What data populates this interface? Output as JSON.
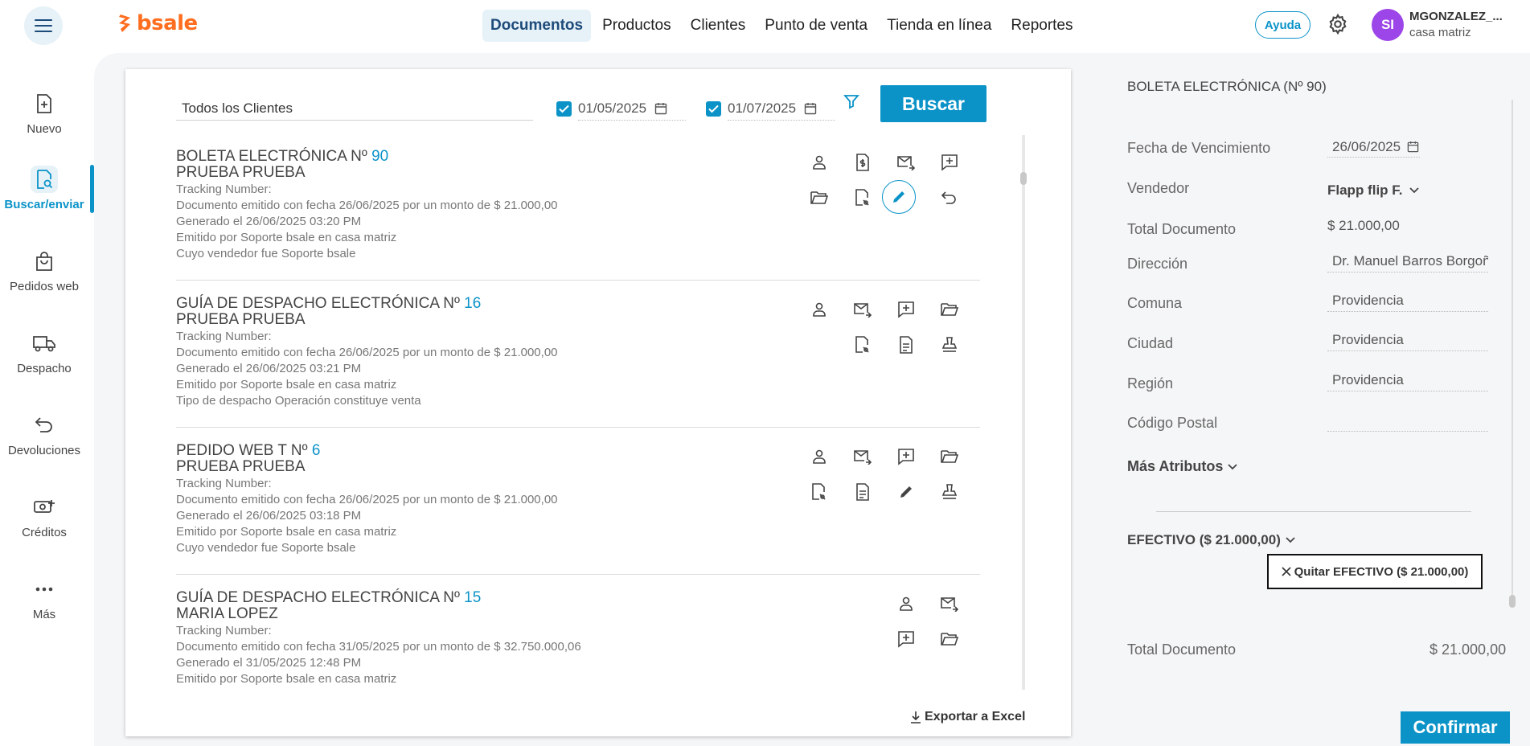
{
  "app": {
    "brand": "bsale",
    "brand_color": "#ff6d1f",
    "accent_color": "#0b93c8"
  },
  "nav": {
    "items": [
      {
        "label": "Documentos",
        "active": true
      },
      {
        "label": "Productos"
      },
      {
        "label": "Clientes"
      },
      {
        "label": "Punto de venta"
      },
      {
        "label": "Tienda en línea"
      },
      {
        "label": "Reportes"
      }
    ]
  },
  "header": {
    "help_label": "Ayuda",
    "avatar_initials": "SI",
    "user_name": "MGONZALEZ_...",
    "user_branch": "casa matriz"
  },
  "sidebar": {
    "items": [
      {
        "label": "Nuevo",
        "icon": "new-document-icon"
      },
      {
        "label": "Buscar/enviar",
        "icon": "search-document-icon",
        "active": true
      },
      {
        "label": "Pedidos web",
        "icon": "shopping-bag-icon"
      },
      {
        "label": "Despacho",
        "icon": "truck-icon"
      },
      {
        "label": "Devoluciones",
        "icon": "return-arrow-icon"
      },
      {
        "label": "Créditos",
        "icon": "credit-icon"
      },
      {
        "label": "Más",
        "icon": "more-dots-icon"
      }
    ]
  },
  "search": {
    "client_value": "Todos los Clientes",
    "date_from": "01/05/2025",
    "date_to": "01/07/2025",
    "search_button": "Buscar"
  },
  "documents": [
    {
      "title": "BOLETA ELECTRÓNICA Nº",
      "number": "90",
      "client": "PRUEBA PRUEBA",
      "lines": [
        "Tracking Number:",
        "Documento emitido con fecha 26/06/2025 por un monto de $ 21.000,00",
        "Generado el 26/06/2025 03:20 PM",
        "Emitido por Soporte bsale en casa matriz",
        "Cuyo vendedor fue Soporte bsale"
      ]
    },
    {
      "title": "GUÍA DE DESPACHO ELECTRÓNICA Nº",
      "number": "16",
      "client": "PRUEBA PRUEBA",
      "lines": [
        "Tracking Number:",
        "Documento emitido con fecha 26/06/2025 por un monto de $ 21.000,00",
        "Generado el 26/06/2025 03:21 PM",
        "Emitido por Soporte bsale en casa matriz",
        "Tipo de despacho Operación constituye venta"
      ]
    },
    {
      "title": "PEDIDO WEB T Nº",
      "number": "6",
      "client": "PRUEBA PRUEBA",
      "lines": [
        "Tracking Number:",
        "Documento emitido con fecha 26/06/2025 por un monto de $ 21.000,00",
        "Generado el 26/06/2025 03:18 PM",
        "Emitido por Soporte bsale en casa matriz",
        "Cuyo vendedor fue Soporte bsale"
      ]
    },
    {
      "title": "GUÍA DE DESPACHO ELECTRÓNICA Nº",
      "number": "15",
      "client": "MARIA LOPEZ",
      "lines": [
        "Tracking Number:",
        "Documento emitido con fecha 31/05/2025 por un monto de $ 32.750.000,06",
        "Generado el 31/05/2025 12:48 PM",
        "Emitido por Soporte bsale en casa matriz"
      ]
    }
  ],
  "export_label": "Exportar a Excel",
  "detail": {
    "title": "BOLETA ELECTRÓNICA (Nº 90)",
    "fields": {
      "due_date_label": "Fecha de Vencimiento",
      "due_date_value": "26/06/2025",
      "seller_label": "Vendedor",
      "seller_value": "Flapp flip F.",
      "total_label": "Total Documento",
      "total_value": "$ 21.000,00",
      "address_label": "Dirección",
      "address_value": "Dr. Manuel Barros Borgoño",
      "comuna_label": "Comuna",
      "comuna_value": "Providencia",
      "city_label": "Ciudad",
      "city_value": "Providencia",
      "region_label": "Región",
      "region_value": "Providencia",
      "postal_label": "Código Postal",
      "postal_value": ""
    },
    "more_attributes": "Más Atributos",
    "payment_label": "EFECTIVO ($ 21.000,00)",
    "remove_payment": "Quitar EFECTIVO ($ 21.000,00)",
    "footer_total_label": "Total Documento",
    "footer_total_value": "$ 21.000,00",
    "confirm_button": "Confirmar"
  }
}
